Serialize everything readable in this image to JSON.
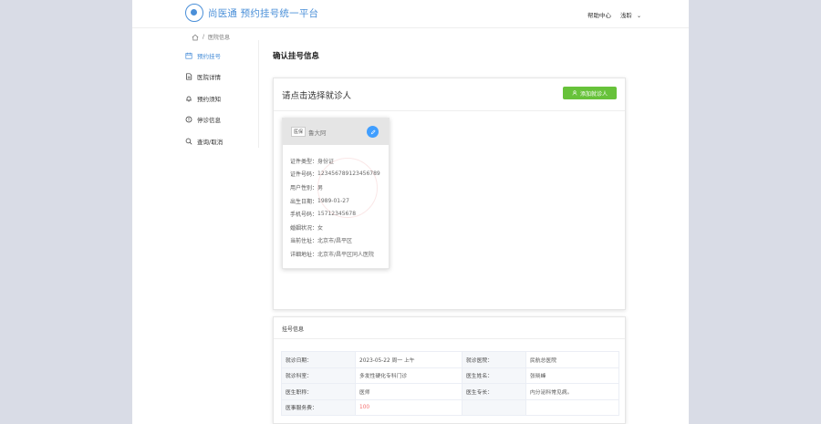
{
  "header": {
    "logo_text": "尚医通 预约挂号统一平台",
    "help_center": "帮助中心",
    "user_name": "浅聆"
  },
  "breadcrumb": {
    "current": "医院信息"
  },
  "sidebar": {
    "items": [
      {
        "label": "预约挂号",
        "icon": "calendar-icon",
        "active": true
      },
      {
        "label": "医院详情",
        "icon": "document-icon",
        "active": false
      },
      {
        "label": "预约须知",
        "icon": "bell-icon",
        "active": false
      },
      {
        "label": "停诊信息",
        "icon": "info-icon",
        "active": false
      },
      {
        "label": "查询/取消",
        "icon": "search-icon",
        "active": false
      }
    ]
  },
  "main": {
    "title": "确认挂号信息",
    "select_patient": {
      "title": "请点击选择就诊人",
      "add_button": "添加就诊人"
    },
    "patient": {
      "tag": "医保",
      "name": "鲁大阿",
      "fields": [
        {
          "label": "证件类型：",
          "value": "身份证"
        },
        {
          "label": "证件号码：",
          "value": "123456789123456789"
        },
        {
          "label": "用户性别：",
          "value": "男"
        },
        {
          "label": "出生日期：",
          "value": "1989-01-27"
        },
        {
          "label": "手机号码：",
          "value": "15712345678"
        },
        {
          "label": "婚姻状况：",
          "value": "女"
        },
        {
          "label": "当前住址：",
          "value": "北京市/昌平区"
        },
        {
          "label": "详细地址：",
          "value": "北京市/昌平区同人医院"
        }
      ]
    },
    "register_info": {
      "title": "挂号信息",
      "rows": [
        [
          "就诊日期：",
          "2023-05-22 周一 上午",
          "就诊医院：",
          "民航总医院"
        ],
        [
          "就诊科室：",
          "多发性硬化专科门诊",
          "医生姓名：",
          "张晓峰"
        ],
        [
          "医生职称：",
          "医师",
          "医生专长：",
          "内分泌科常见病。"
        ],
        [
          "医事服务费：",
          "100",
          "",
          ""
        ]
      ]
    }
  },
  "colors": {
    "accent": "#4a8fd8",
    "add_button": "#67c23a",
    "fee": "#f56c6c",
    "edit_button": "#409eff"
  }
}
